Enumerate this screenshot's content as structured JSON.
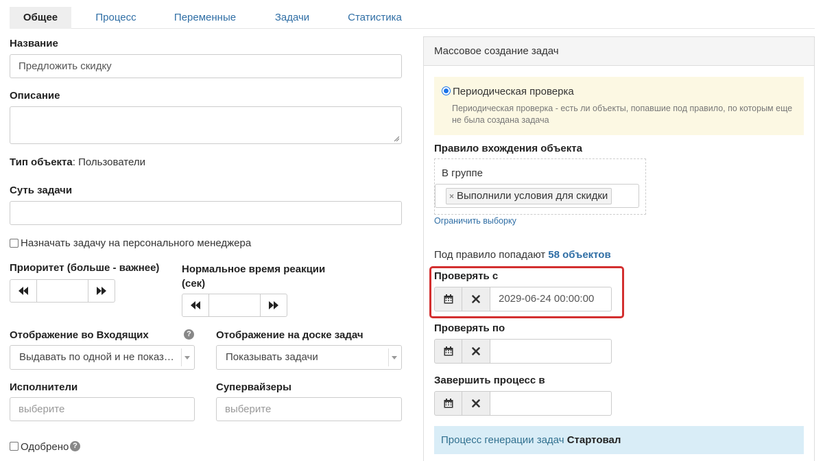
{
  "tabs": [
    {
      "label": "Общее",
      "active": true
    },
    {
      "label": "Процесс",
      "active": false
    },
    {
      "label": "Переменные",
      "active": false
    },
    {
      "label": "Задачи",
      "active": false
    },
    {
      "label": "Статистика",
      "active": false
    }
  ],
  "form": {
    "name_label": "Название",
    "name_value": "Предложить скидку",
    "description_label": "Описание",
    "description_value": "",
    "object_type_label": "Тип объекта",
    "object_type_value": ": Пользователи",
    "task_essence_label": "Суть задачи",
    "task_essence_value": "",
    "assign_manager_label": "Назначать задачу на персонального менеджера",
    "assign_manager_checked": false,
    "priority_label": "Приоритет (больше - важнее)",
    "priority_value": "",
    "reaction_time_label_line1": "Нормальное время реакции",
    "reaction_time_label_line2": "(сек)",
    "reaction_time_value": "",
    "inbox_display_label": "Отображение во Входящих",
    "inbox_display_value": "Выдавать по одной и не показ…",
    "board_display_label": "Отображение на доске задач",
    "board_display_value": "Показывать задачи",
    "executors_label": "Исполнители",
    "executors_placeholder": "выберите",
    "supervisors_label": "Супервайзеры",
    "supervisors_placeholder": "выберите",
    "approved_label": "Одобрено",
    "approved_checked": false
  },
  "panel": {
    "title": "Массовое создание задач",
    "radio_label": "Периодическая проверка",
    "radio_desc_line1": "Периодическая проверка - есть ли объекты, попавшие под правило, по которым еще",
    "radio_desc_line2": "не была создана задача",
    "rule_label": "Правило вхождения объекта",
    "group_label": "В группе",
    "group_chip": "Выполнили условия для скидки",
    "limit_link": "Ограничить выборку",
    "count_prefix": "Под правило попадают",
    "count_value": "58 объектов",
    "check_from_label": "Проверять с",
    "check_from_value": "2029-06-24 00:00:00",
    "check_to_label": "Проверять по",
    "check_to_value": "",
    "finish_label": "Завершить процесс в",
    "finish_value": "",
    "status_prefix": "Процесс генерации задач",
    "status_value": "Стартовал"
  },
  "colors": {
    "link": "#2f6ea5",
    "highlight": "#d32f2f",
    "note_bg": "#fcf8e3",
    "info_bg": "#d9edf7"
  },
  "icons": [
    "prev-icon",
    "next-icon",
    "calendar-icon",
    "clear-icon",
    "help-icon",
    "caret-down-icon",
    "remove-chip-icon"
  ]
}
